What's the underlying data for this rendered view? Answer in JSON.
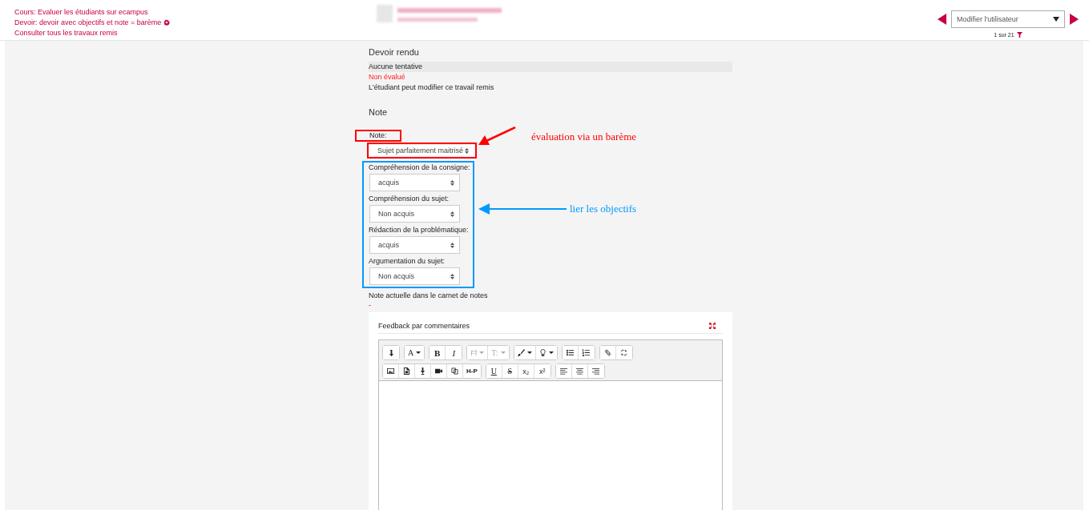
{
  "breadcrumbs": [
    {
      "text": "Cours: Evaluer les étudiants sur ecampus",
      "settings": false
    },
    {
      "text": "Devoir: devoir avec objectifs et note = barème",
      "settings": true
    },
    {
      "text": "Consulter tous les travaux remis",
      "settings": false
    }
  ],
  "user_nav": {
    "placeholder": "Modifier l'utilisateur",
    "counter": "1 sur 21"
  },
  "submission": {
    "heading": "Devoir rendu",
    "rows": [
      {
        "text": "Aucune tentative",
        "kind": "shaded"
      },
      {
        "text": "Non évalué",
        "kind": "alert"
      },
      {
        "text": "L'étudiant peut modifier ce travail remis",
        "kind": "plain"
      }
    ]
  },
  "grade": {
    "heading": "Note",
    "label": "Note:",
    "value": "Sujet parfaitement maitrisé",
    "objectives": [
      {
        "label": "Compréhension de la consigne:",
        "value": "acquis"
      },
      {
        "label": "Compréhension du sujet:",
        "value": "Non acquis"
      },
      {
        "label": "Rédaction de la problématique:",
        "value": "acquis"
      },
      {
        "label": "Argumentation du sujet:",
        "value": "Non acquis"
      }
    ],
    "current_label": "Note actuelle dans le carnet de notes",
    "current_value": "-"
  },
  "feedback": {
    "title": "Feedback par commentaires",
    "toolbar": [
      [
        [
          {
            "kind": "icon",
            "dropdown": false,
            "disabled": false
          }
        ],
        [
          {
            "kind": "text",
            "label": "A",
            "dropdown": true,
            "disabled": false
          }
        ],
        [
          {
            "kind": "text",
            "label": "B",
            "dropdown": false,
            "disabled": false
          },
          {
            "kind": "text",
            "label": "I",
            "dropdown": false,
            "disabled": false
          }
        ],
        [
          {
            "kind": "text",
            "label": "Ff",
            "dropdown": true,
            "disabled": true
          },
          {
            "kind": "text",
            "label": "T:",
            "dropdown": true,
            "disabled": true
          }
        ],
        [
          {
            "kind": "icon",
            "dropdown": true,
            "disabled": false
          },
          {
            "kind": "icon",
            "dropdown": true,
            "disabled": false
          }
        ],
        [
          {
            "kind": "icon",
            "dropdown": false,
            "disabled": false
          },
          {
            "kind": "icon",
            "dropdown": false,
            "disabled": false
          }
        ],
        [
          {
            "kind": "icon",
            "dropdown": false,
            "disabled": false
          },
          {
            "kind": "icon",
            "dropdown": false,
            "disabled": false
          }
        ]
      ],
      [
        [
          {
            "kind": "icon",
            "dropdown": false,
            "disabled": false
          },
          {
            "kind": "icon",
            "dropdown": false,
            "disabled": false
          },
          {
            "kind": "icon",
            "dropdown": false,
            "disabled": false
          },
          {
            "kind": "icon",
            "dropdown": false,
            "disabled": false
          },
          {
            "kind": "icon",
            "dropdown": false,
            "disabled": false
          },
          {
            "kind": "text",
            "label": "H-P",
            "dropdown": false,
            "disabled": false
          }
        ],
        [
          {
            "kind": "text",
            "label": "U",
            "dropdown": false,
            "disabled": false
          },
          {
            "kind": "text",
            "label": "S",
            "dropdown": false,
            "disabled": false
          },
          {
            "kind": "text",
            "label": "x₂",
            "dropdown": false,
            "disabled": false
          },
          {
            "kind": "text",
            "label": "x²",
            "dropdown": false,
            "disabled": false
          }
        ],
        [
          {
            "kind": "icon",
            "dropdown": false,
            "disabled": false
          },
          {
            "kind": "icon",
            "dropdown": false,
            "disabled": false
          },
          {
            "kind": "icon",
            "dropdown": false,
            "disabled": false
          }
        ]
      ]
    ]
  },
  "annotations": [
    {
      "text": "évaluation via un barème",
      "color": "#ff0000"
    },
    {
      "text": "lier les objectifs",
      "color": "#0099ff"
    }
  ]
}
